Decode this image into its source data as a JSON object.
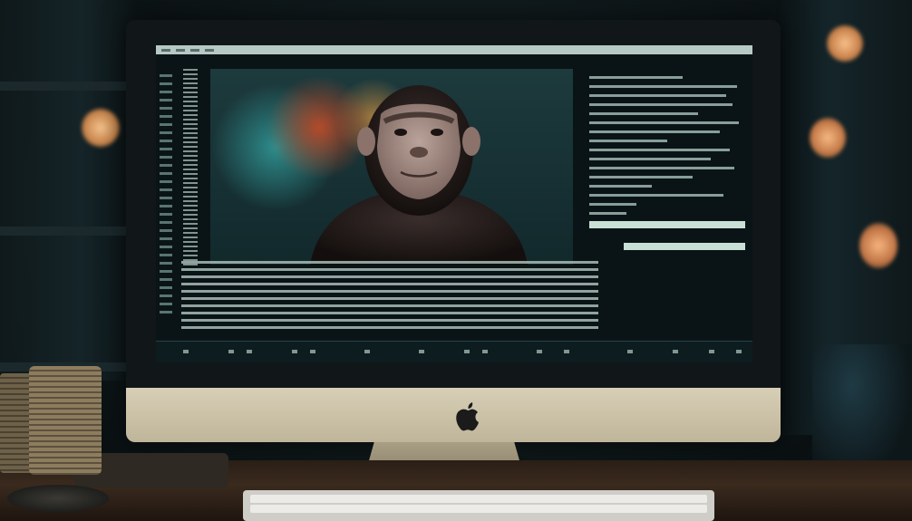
{
  "screen": {
    "app_title": "",
    "panel_heading": "",
    "accent_color": "#c9e0d6"
  },
  "icons": {
    "brand_logo": "apple-logo-icon"
  },
  "colors": {
    "screen_background": "#0a1416",
    "monitor_chin": "#d7cfb6",
    "desk": "#2a1e16",
    "bokeh_light": "#f2b07a"
  }
}
